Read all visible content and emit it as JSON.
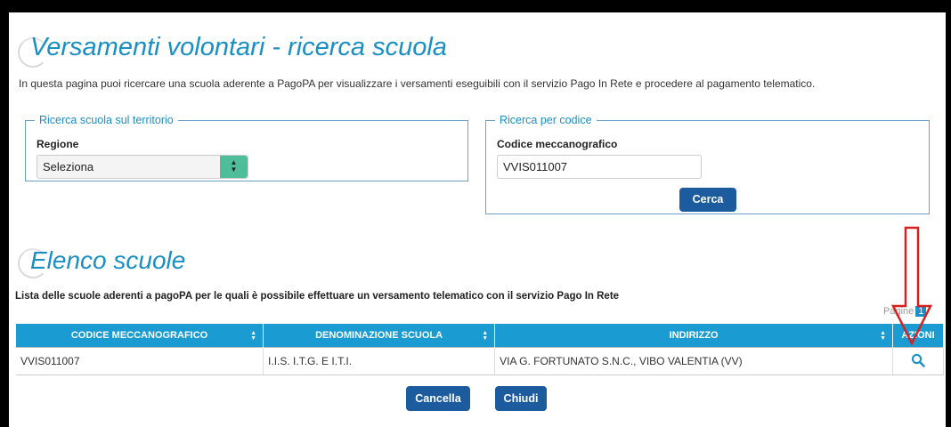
{
  "page": {
    "title": "Versamenti volontari - ricerca scuola",
    "intro": "In questa pagina puoi ricercare una scuola aderente a PagoPA per visualizzare i versamenti eseguibili con il servizio Pago In Rete e procedere al pagamento telematico."
  },
  "territorio": {
    "legend": "Ricerca scuola sul territorio",
    "region_label": "Regione",
    "region_value": "Seleziona"
  },
  "codice": {
    "legend": "Ricerca per codice",
    "field_label": "Codice meccanografico",
    "field_value": "VVIS011007",
    "button": "Cerca"
  },
  "elenco": {
    "title": "Elenco scuole",
    "description": "Lista delle scuole aderenti a pagoPA per le quali è possibile effettuare un versamento telematico con il servizio Pago In Rete",
    "pages_label": "Pagine",
    "page_number": "1"
  },
  "table": {
    "headers": [
      "CODICE MECCANOGRAFICO",
      "DENOMINAZIONE SCUOLA",
      "INDIRIZZO",
      "AZIONI"
    ],
    "rows": [
      {
        "codice": "VVIS011007",
        "denominazione": "I.I.S. I.T.G. E I.T.I.",
        "indirizzo": "VIA G. FORTUNATO S.N.C., VIBO VALENTIA (VV)"
      }
    ]
  },
  "buttons": {
    "cancel": "Cancella",
    "close": "Chiudi"
  },
  "icons": {
    "search": "search-icon",
    "sort": "sort-icon",
    "annotation_arrow": "red-down-arrow"
  },
  "colors": {
    "accent": "#1a8fc4",
    "header_bg": "#1a9bd1",
    "button_bg": "#1c5c9e",
    "select_arrow_bg": "#4dbd9a",
    "annotation": "#d62020"
  }
}
